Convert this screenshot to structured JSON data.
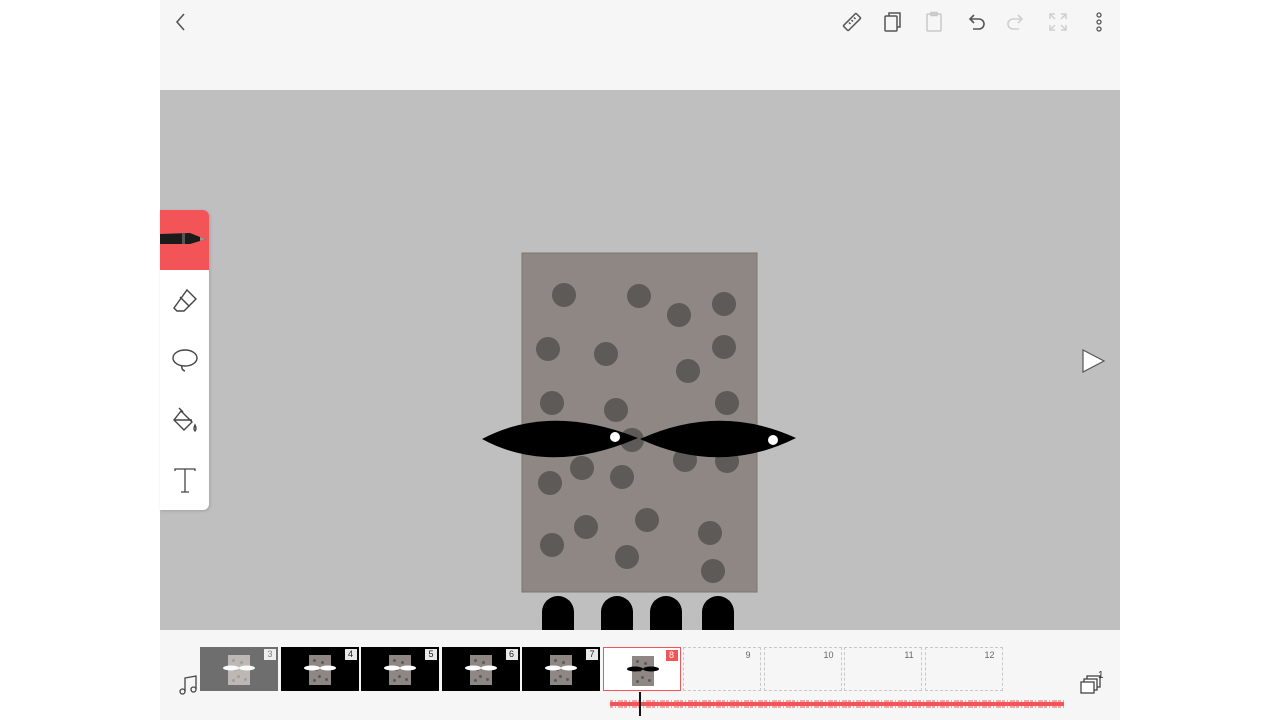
{
  "toolbar": {
    "back": "back-arrow-icon",
    "ruler": "ruler-icon",
    "copy": "copy-icon",
    "paste": "paste-icon",
    "undo": "undo-icon",
    "redo": "redo-icon",
    "fullscreen": "fullscreen-icon",
    "more": "more-vertical-icon"
  },
  "tools": [
    {
      "name": "pen",
      "icon": "pen-icon",
      "active": true
    },
    {
      "name": "eraser",
      "icon": "eraser-icon",
      "active": false
    },
    {
      "name": "lasso",
      "icon": "lasso-icon",
      "active": false
    },
    {
      "name": "fill",
      "icon": "paint-bucket-icon",
      "active": false
    },
    {
      "name": "text",
      "icon": "text-icon",
      "active": false
    }
  ],
  "canvas": {
    "background_color": "#bfbfbf",
    "body_color": "#8f8783",
    "spot_color": "#5e5a58",
    "eye_color": "#000000",
    "pupil_color": "#ffffff"
  },
  "timeline": {
    "frames": [
      {
        "number": "3",
        "state": "filled"
      },
      {
        "number": "4",
        "state": "filled"
      },
      {
        "number": "5",
        "state": "filled"
      },
      {
        "number": "6",
        "state": "filled"
      },
      {
        "number": "7",
        "state": "filled"
      },
      {
        "number": "8",
        "state": "current"
      },
      {
        "number": "9",
        "state": "empty"
      },
      {
        "number": "10",
        "state": "empty"
      },
      {
        "number": "11",
        "state": "empty"
      },
      {
        "number": "12",
        "state": "empty"
      }
    ],
    "layer_count": "1",
    "accent_color": "#f25458"
  }
}
